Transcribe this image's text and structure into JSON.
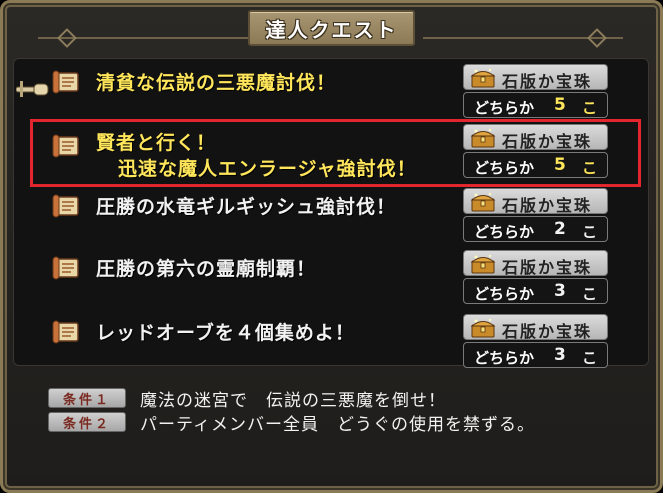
{
  "title": "達人クエスト",
  "quests": [
    {
      "name_lines": [
        "清貧な伝説の三悪魔討伐！"
      ],
      "name_color": "#ffe65a",
      "reward_label": "石版か宝珠",
      "either_label": "どちらか",
      "count": "5",
      "count_unit": "こ",
      "count_color": "#ffe65a",
      "selected": false,
      "cursor": true
    },
    {
      "name_lines": [
        "賢者と行く！",
        "迅速な魔人エンラージャ強討伐！"
      ],
      "name_color": "#ffe65a",
      "reward_label": "石版か宝珠",
      "either_label": "どちらか",
      "count": "5",
      "count_unit": "こ",
      "count_color": "#ffe65a",
      "selected": true,
      "cursor": false
    },
    {
      "name_lines": [
        "圧勝の水竜ギルギッシュ強討伐！"
      ],
      "name_color": "#f2f2f2",
      "reward_label": "石版か宝珠",
      "either_label": "どちらか",
      "count": "2",
      "count_unit": "こ",
      "count_color": "#f2f2f2",
      "selected": false,
      "cursor": false
    },
    {
      "name_lines": [
        "圧勝の第六の霊廟制覇！"
      ],
      "name_color": "#f2f2f2",
      "reward_label": "石版か宝珠",
      "either_label": "どちらか",
      "count": "3",
      "count_unit": "こ",
      "count_color": "#f2f2f2",
      "selected": false,
      "cursor": false
    },
    {
      "name_lines": [
        "レッドオーブを４個集めよ！"
      ],
      "name_color": "#f2f2f2",
      "reward_label": "石版か宝珠",
      "either_label": "どちらか",
      "count": "3",
      "count_unit": "こ",
      "count_color": "#f2f2f2",
      "selected": false,
      "cursor": false
    }
  ],
  "conditions": [
    {
      "tag": "条件１",
      "text": "魔法の迷宮で　伝説の三悪魔を倒せ！"
    },
    {
      "tag": "条件２",
      "text": "パーティメンバー全員　どうぐの使用を禁ずる。"
    }
  ],
  "colors": {
    "highlight": "#e3262e",
    "accent_yellow": "#ffe65a",
    "frame": "#8a7a55"
  }
}
